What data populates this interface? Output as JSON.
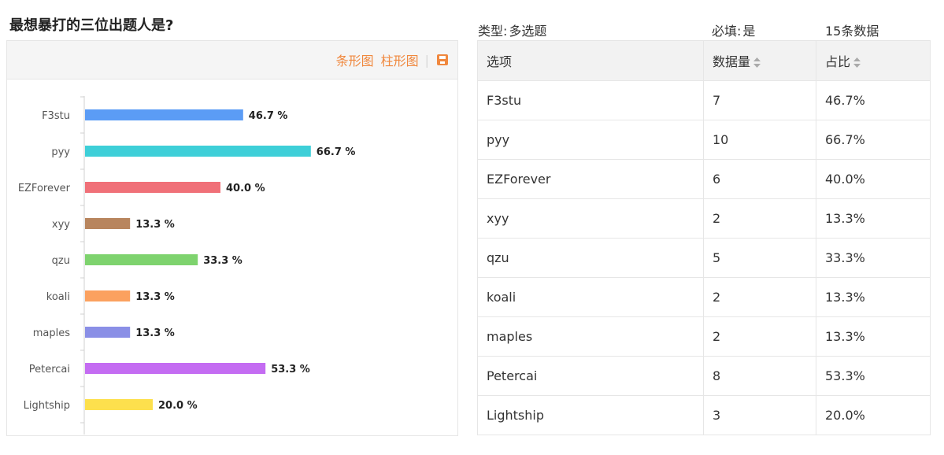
{
  "title": "最想暴打的三位出题人是?",
  "toolbar": {
    "bar_label": "条形图",
    "column_label": "柱形图"
  },
  "meta": {
    "type_key": "类型:",
    "type_value": "多选题",
    "required_key": "必填:",
    "required_value": "是",
    "count_text": "15条数据"
  },
  "table": {
    "headers": [
      "选项",
      "数据量",
      "占比"
    ],
    "rows": [
      [
        "F3stu",
        "7",
        "46.7%"
      ],
      [
        "pyy",
        "10",
        "66.7%"
      ],
      [
        "EZForever",
        "6",
        "40.0%"
      ],
      [
        "xyy",
        "2",
        "13.3%"
      ],
      [
        "qzu",
        "5",
        "33.3%"
      ],
      [
        "koali",
        "2",
        "13.3%"
      ],
      [
        "maples",
        "2",
        "13.3%"
      ],
      [
        "Petercai",
        "8",
        "53.3%"
      ],
      [
        "Lightship",
        "3",
        "20.0%"
      ]
    ]
  },
  "chart_data": {
    "type": "bar",
    "orientation": "horizontal",
    "categories": [
      "F3stu",
      "pyy",
      "EZForever",
      "xyy",
      "qzu",
      "koali",
      "maples",
      "Petercai",
      "Lightship"
    ],
    "values": [
      46.7,
      66.7,
      40.0,
      13.3,
      33.3,
      13.3,
      13.3,
      53.3,
      20.0
    ],
    "data_labels": [
      "46.7 %",
      "66.7 %",
      "40.0 %",
      "13.3 %",
      "33.3 %",
      "13.3 %",
      "13.3 %",
      "53.3 %",
      "20.0 %"
    ],
    "colors": [
      "#5b9cf5",
      "#3ecfd8",
      "#f07078",
      "#b8855e",
      "#7ed36e",
      "#fba15f",
      "#8a8fe6",
      "#c46cf2",
      "#fde04d"
    ],
    "xlim": [
      0,
      100
    ],
    "grid": false,
    "legend": "none",
    "title": "",
    "xlabel": "",
    "ylabel": ""
  },
  "colors": {
    "accent": "#f0883e"
  }
}
